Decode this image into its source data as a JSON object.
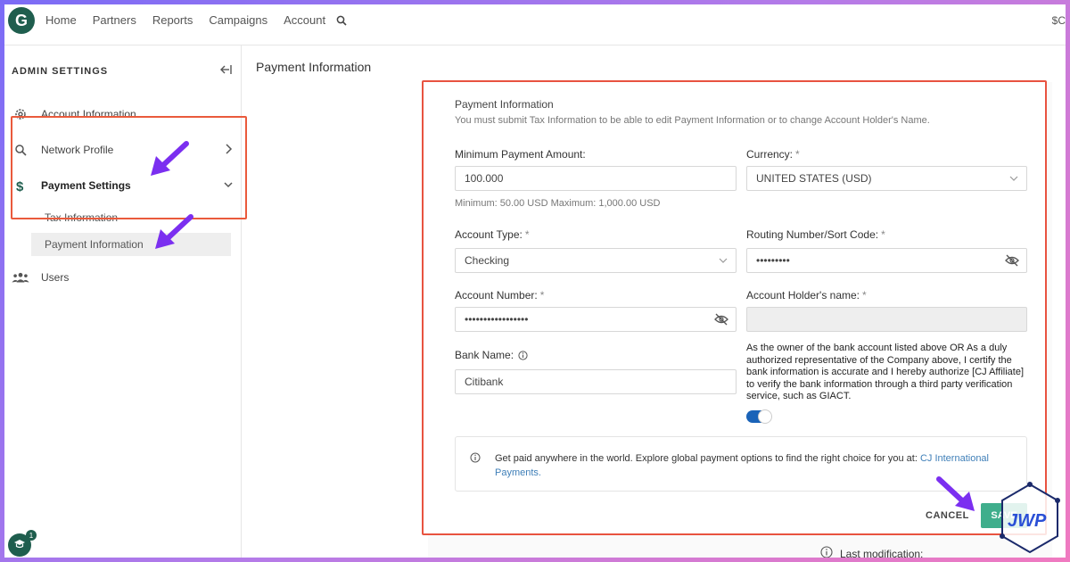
{
  "nav": {
    "logo": "G",
    "links": [
      "Home",
      "Partners",
      "Reports",
      "Campaigns",
      "Account"
    ],
    "right_text": "$C"
  },
  "sidebar": {
    "title": "ADMIN SETTINGS",
    "items": [
      {
        "label": "Account Information",
        "icon": "gear-icon"
      },
      {
        "label": "Network Profile",
        "icon": "search-icon"
      },
      {
        "label": "Payment Settings",
        "icon": "dollar-icon"
      },
      {
        "label": "Users",
        "icon": "users-icon"
      }
    ],
    "sub_items": [
      "Tax Information",
      "Payment Information"
    ],
    "badge_count": "1"
  },
  "page": {
    "title": "Payment Information"
  },
  "form": {
    "heading": "Payment Information",
    "note": "You must submit Tax Information to be able to edit Payment Information or to change Account Holder's Name.",
    "min_payment_label": "Minimum Payment Amount:",
    "min_payment_value": "100.000",
    "min_payment_hint": "Minimum: 50.00 USD Maximum: 1,000.00 USD",
    "currency_label": "Currency:",
    "currency_value": "UNITED STATES (USD)",
    "account_type_label": "Account Type:",
    "account_type_value": "Checking",
    "routing_label": "Routing Number/Sort Code:",
    "routing_value": "•••••••••",
    "account_number_label": "Account Number:",
    "account_number_value": "•••••••••••••••••",
    "holder_label": "Account Holder's name:",
    "holder_value": "",
    "bank_label": "Bank Name:",
    "bank_value": "Citibank",
    "required_mark": "*",
    "consent": "As the owner of the bank account listed above OR As a duly authorized representative of the Company above, I certify the bank information is accurate and I hereby authorize [CJ Affiliate] to verify the bank information through a third party verification service, such as GIACT.",
    "toggle_on": true,
    "info_text": "Get paid anywhere in the world. Explore global payment options to find the right choice for you at: ",
    "info_link": "CJ International Payments.",
    "cancel_label": "CANCEL",
    "save_label": "SAVE",
    "last_modification": "Last modification:"
  },
  "colors": {
    "brand_green": "#1f5e4e",
    "save_green": "#3fae8c",
    "highlight": "#e85340",
    "arrow": "#7b2ff0",
    "link": "#3f7fb8",
    "toggle": "#1a63b8"
  },
  "watermark": {
    "text": "JWP"
  }
}
